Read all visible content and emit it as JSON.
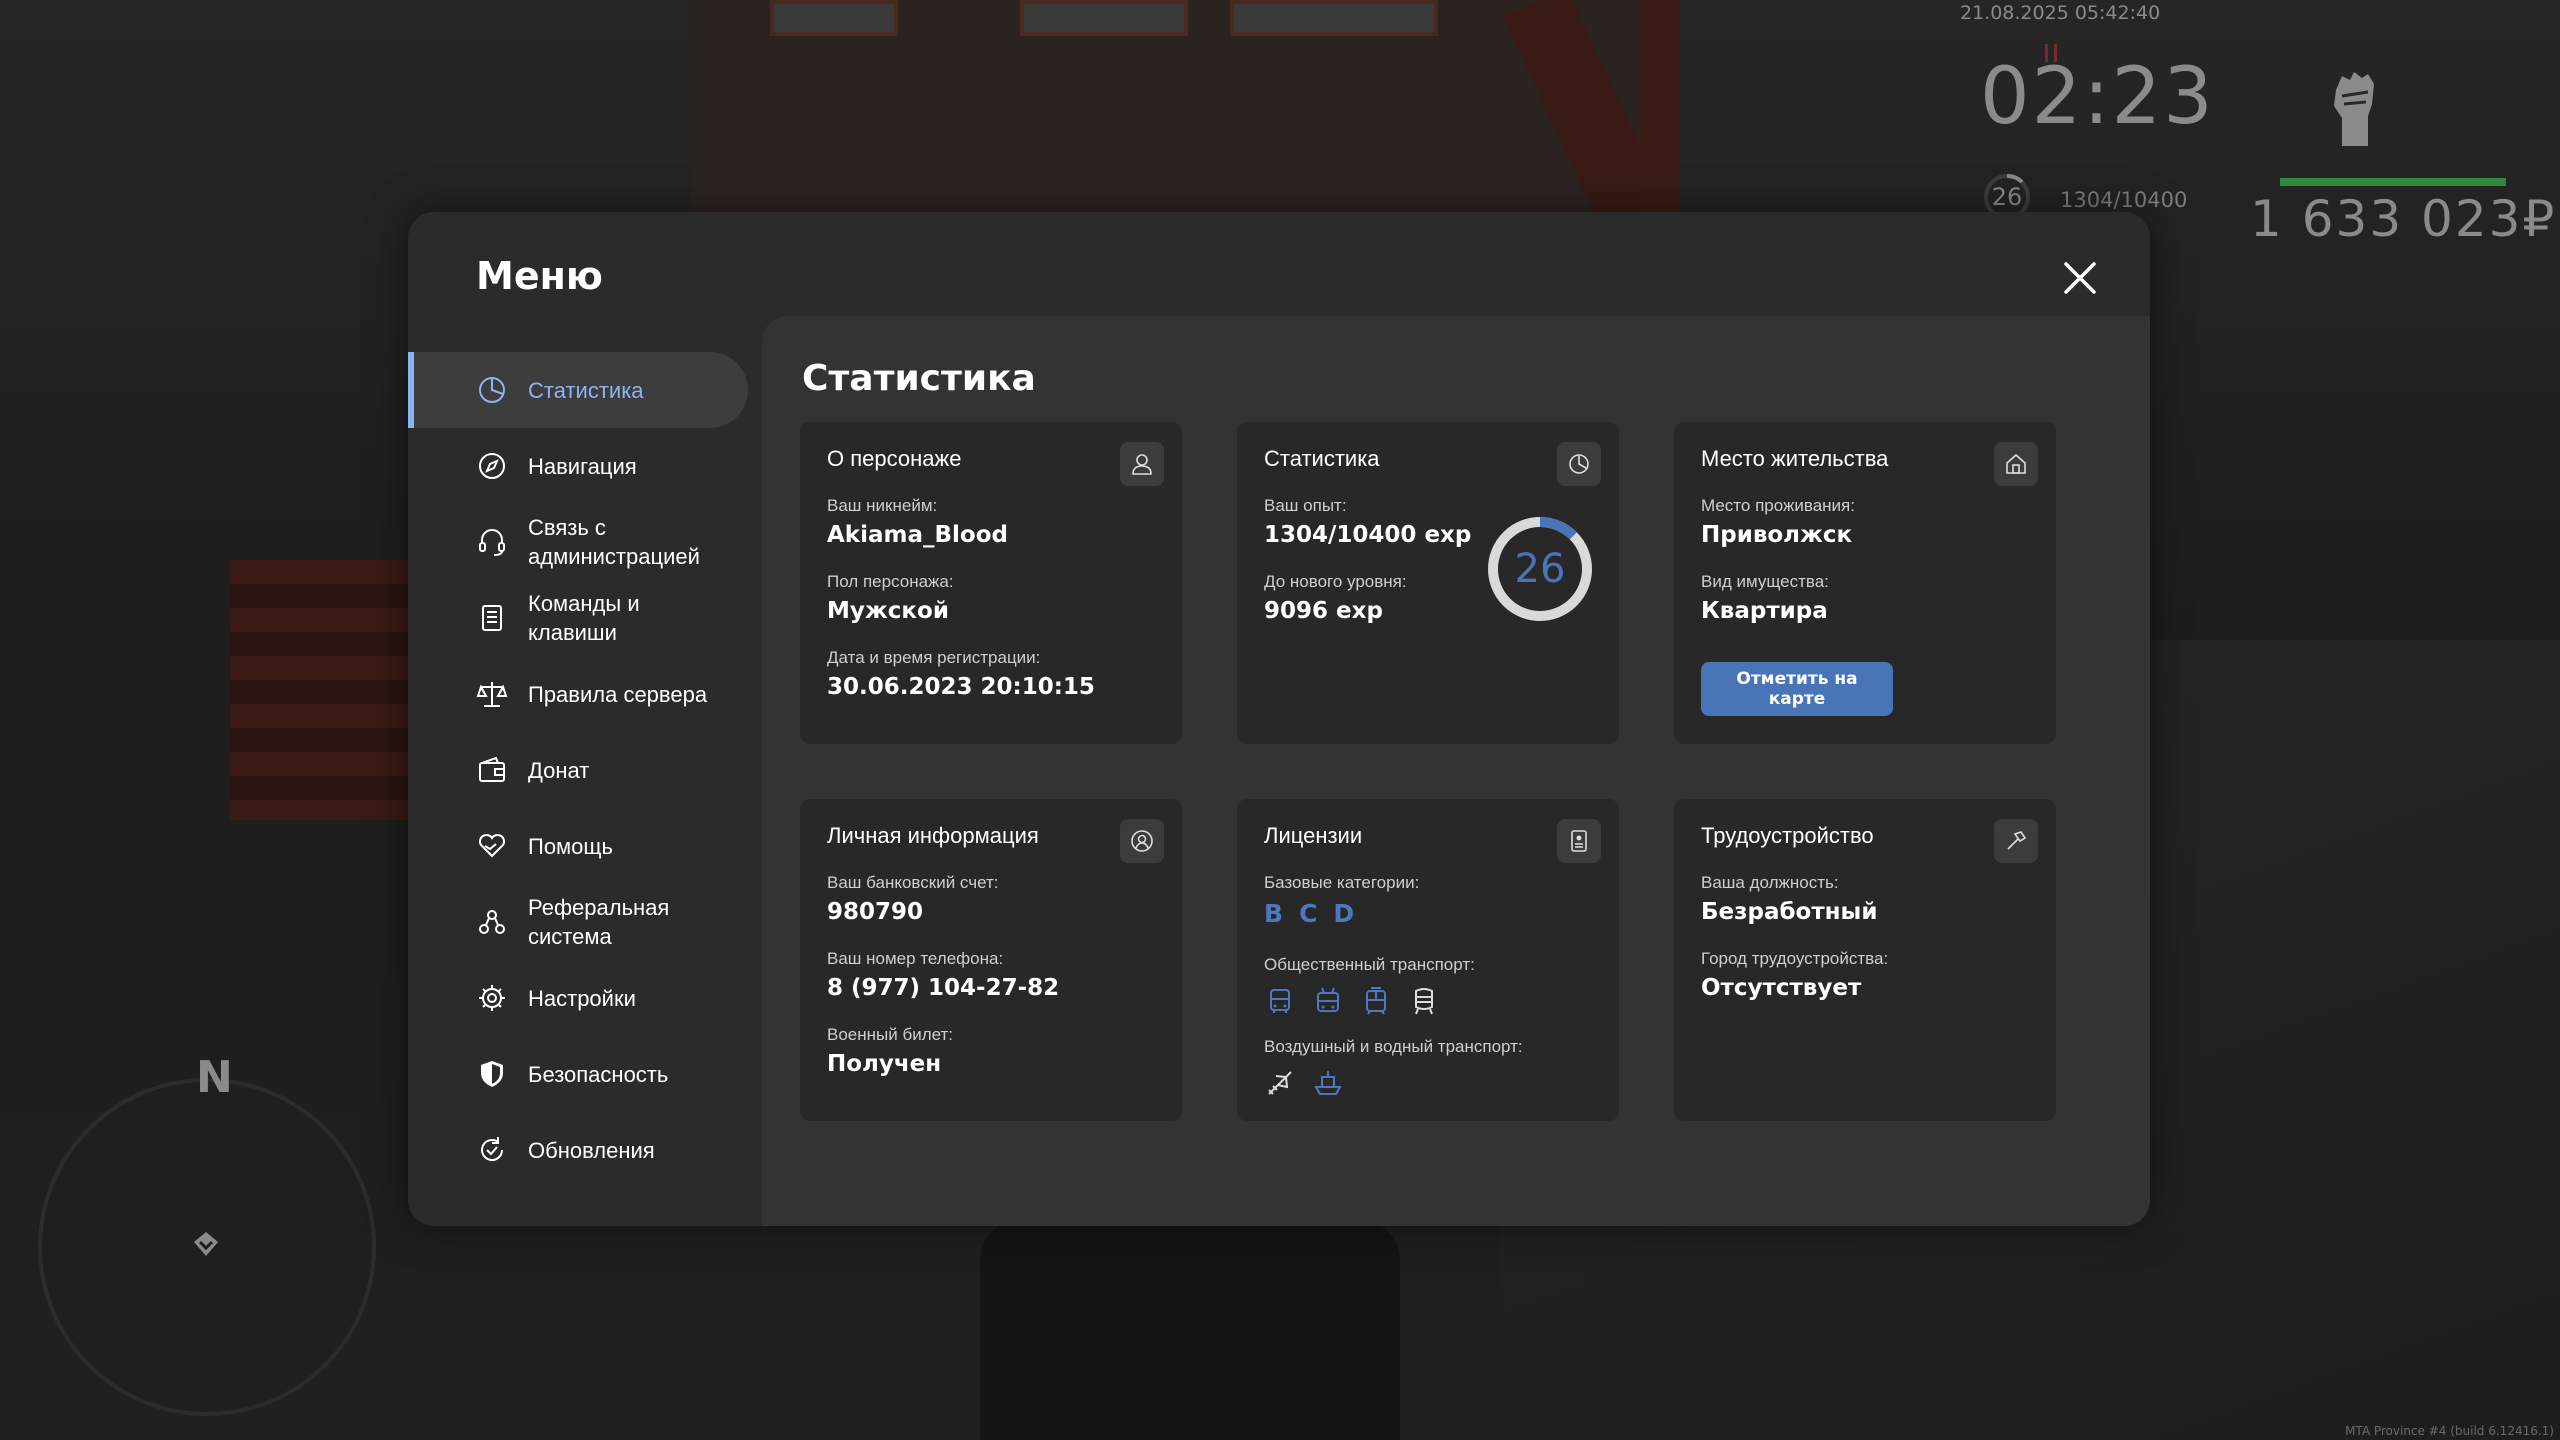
{
  "hud": {
    "datetime": "21.08.2025 05:42:40",
    "clock": "02:23",
    "level": "26",
    "exp": "1304/10400",
    "money": "1 633 023₽",
    "compass": "N",
    "build": "MTA Province #4 (build 6.12416.1)"
  },
  "menu": {
    "title": "Меню",
    "sidebar": [
      {
        "label": "Статистика",
        "icon": "pie-chart-icon",
        "active": true
      },
      {
        "label": "Навигация",
        "icon": "compass-icon"
      },
      {
        "label": "Связь с администрацией",
        "icon": "headset-icon"
      },
      {
        "label": "Команды и клавиши",
        "icon": "document-list-icon"
      },
      {
        "label": "Правила сервера",
        "icon": "scales-icon"
      },
      {
        "label": "Донат",
        "icon": "wallet-icon"
      },
      {
        "label": "Помощь",
        "icon": "heart-hands-icon"
      },
      {
        "label": "Реферальная система",
        "icon": "referral-icon"
      },
      {
        "label": "Настройки",
        "icon": "gear-icon"
      },
      {
        "label": "Безопасность",
        "icon": "shield-icon"
      },
      {
        "label": "Обновления",
        "icon": "refresh-check-icon"
      }
    ],
    "content_title": "Статистика",
    "accent_color": "#8cb4f2",
    "button_color": "#4874b8"
  },
  "cards": {
    "character": {
      "title": "О персонаже",
      "nickname_label": "Ваш никнейм:",
      "nickname": "Akiama_Blood",
      "gender_label": "Пол персонажа:",
      "gender": "Мужской",
      "reg_label": "Дата и время регистрации:",
      "reg": "30.06.2023 20:10:15"
    },
    "stats": {
      "title": "Статистика",
      "exp_label": "Ваш опыт:",
      "exp": "1304/10400 exp",
      "next_label": "До нового уровня:",
      "next": "9096 exp",
      "level": "26",
      "progress": 0.125
    },
    "residence": {
      "title": "Место жительства",
      "place_label": "Место проживания:",
      "place": "Приволжск",
      "property_label": "Вид имущества:",
      "property": "Квартира",
      "button": "Отметить на карте"
    },
    "personal": {
      "title": "Личная информация",
      "bank_label": "Ваш банковский счет:",
      "bank": "980790",
      "phone_label": "Ваш номер телефона:",
      "phone": "8 (977) 104-27-82",
      "military_label": "Военный билет:",
      "military": "Получен"
    },
    "licenses": {
      "title": "Лицензии",
      "base_label": "Базовые категории:",
      "categories": [
        "B",
        "C",
        "D"
      ],
      "public_label": "Общественный транспорт:",
      "public_icons": [
        "bus-icon",
        "trolleybus-icon",
        "tram-icon",
        "train-icon"
      ],
      "air_label": "Воздушный и водный транспорт:",
      "air_icons": [
        "plane-icon",
        "ship-icon"
      ]
    },
    "job": {
      "title": "Трудоустройство",
      "position_label": "Ваша должность:",
      "position": "Безработный",
      "city_label": "Город трудоустройства:",
      "city": "Отсутствует"
    }
  }
}
